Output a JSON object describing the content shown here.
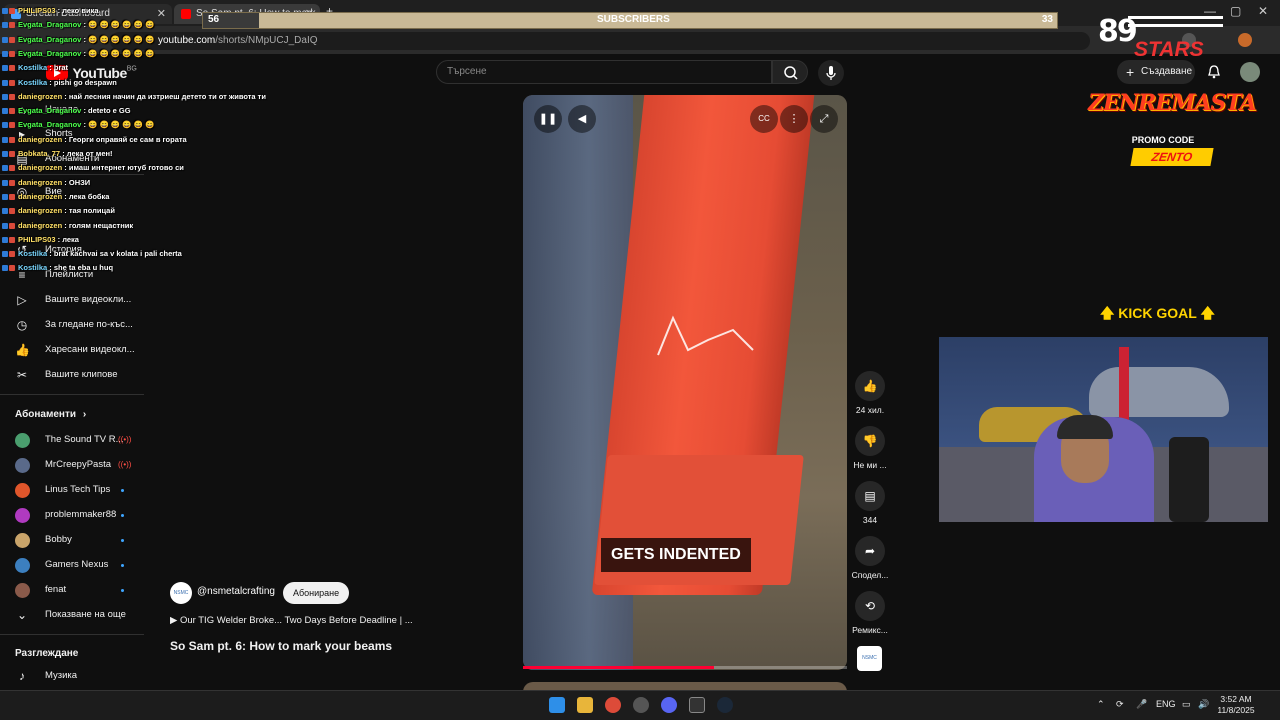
{
  "browser": {
    "tabs": [
      {
        "label": "Stream Dashboard",
        "close": "✕"
      },
      {
        "label": "So Sam pt. 6: How to mark",
        "close": "✕"
      }
    ],
    "new_tab": "+",
    "url_host": "youtube.com",
    "url_path": "/shorts/NMpUCJ_DaIQ",
    "window_controls": [
      "—",
      "▢",
      "✕"
    ]
  },
  "overlay": {
    "subscribers_label": "SUBSCRIBERS",
    "subscribers_current": "56",
    "subscribers_goal": "33",
    "subscribers_progress": 0.066,
    "brand_number": "89",
    "brand_word": "STARS",
    "sponsor_name": "ZENREMASTA",
    "promo_label": "PROMO CODE",
    "promo_code": "ZENTO",
    "kick_goal": "KICK GOAL",
    "chat": [
      {
        "user": "PHILIPS03",
        "text": "леко вика"
      },
      {
        "user": "Evgata_Draganov",
        "text": "😄 😄 😄 😄 😄 😄"
      },
      {
        "user": "Evgata_Draganov",
        "text": "😄 😄 😄 😄 😄 😄"
      },
      {
        "user": "Evgata_Draganov",
        "text": "😄 😄 😄 😄 😄 😄"
      },
      {
        "user": "Kostilka",
        "text": "brat"
      },
      {
        "user": "Kostilka",
        "text": "pishi go despawn"
      },
      {
        "user": "daniegrozen",
        "text": "най лесния начин да изтриеш детето ти от живота ти"
      },
      {
        "user": "Evgata_Draganov",
        "text": "deteto e GG"
      },
      {
        "user": "Evgata_Draganov",
        "text": "😄 😄 😄 😄 😄 😄"
      },
      {
        "user": "daniegrozen",
        "text": "Георги оправяй се сам в гората"
      },
      {
        "user": "Bobkata_77",
        "text": "лека от мен!"
      },
      {
        "user": "daniegrozen",
        "text": "имаш интернет ютуб готово си"
      },
      {
        "user": "daniegrozen",
        "text": "ОНЗИ"
      },
      {
        "user": "daniegrozen",
        "text": "лека бобка"
      },
      {
        "user": "daniegrozen",
        "text": "тая полицай"
      },
      {
        "user": "daniegrozen",
        "text": "голям нещастник"
      },
      {
        "user": "PHILIPS03",
        "text": "лека"
      },
      {
        "user": "Kostilka",
        "text": "brat kachvai sa v kolata i pali cherta"
      },
      {
        "user": "Kostilka",
        "text": "she ta eba u huq"
      }
    ]
  },
  "header": {
    "logo": "YouTube",
    "logo_region": "BG",
    "search_placeholder": "Търсене",
    "create_label": "Създаване"
  },
  "sidebar": {
    "top_items": [
      {
        "label": "Начало",
        "icon": "home-icon",
        "glyph": "⌂"
      },
      {
        "label": "Shorts",
        "icon": "shorts-icon",
        "glyph": "▸"
      },
      {
        "label": "Абонаменти",
        "icon": "subscriptions-icon",
        "glyph": "▤"
      }
    ],
    "you_items": [
      {
        "label": "Вие",
        "icon": "you-icon",
        "glyph": "◎"
      },
      {
        "label": "История",
        "icon": "history-icon",
        "glyph": "↺"
      },
      {
        "label": "Плейлисти",
        "icon": "playlists-icon",
        "glyph": "≡"
      },
      {
        "label": "Вашите видеокли...",
        "icon": "your-videos-icon",
        "glyph": "▷"
      },
      {
        "label": "За гледане по-къс...",
        "icon": "watch-later-icon",
        "glyph": "◷"
      },
      {
        "label": "Харесани видеокл...",
        "icon": "liked-videos-icon",
        "glyph": "👍"
      },
      {
        "label": "Вашите клипове",
        "icon": "clips-icon",
        "glyph": "✂"
      }
    ],
    "subs_title": "Абонаменти",
    "subs_chevron": "›",
    "subscriptions": [
      {
        "label": "The Sound TV R...",
        "color": "#4a9e6e",
        "status": "live"
      },
      {
        "label": "MrCreepyPasta",
        "color": "#5a6a8a",
        "status": "live"
      },
      {
        "label": "Linus Tech Tips",
        "color": "#e0562b",
        "status": "new"
      },
      {
        "label": "problemmaker88",
        "color": "#b03ac0",
        "status": "new"
      },
      {
        "label": "Bobby",
        "color": "#c9a46a",
        "status": "new"
      },
      {
        "label": "Gamers Nexus",
        "color": "#3c7fbf",
        "status": "new"
      },
      {
        "label": "fenat",
        "color": "#8a5a4a",
        "status": "new"
      }
    ],
    "show_more": "Показване на още",
    "explore_title": "Разглеждане",
    "explore_items": [
      {
        "label": "Музика",
        "icon": "music-icon",
        "glyph": "♪"
      }
    ]
  },
  "short": {
    "caption": "GETS INDENTED",
    "channel": "@nsmetalcrafting",
    "channel_abbr": "NSMC",
    "subscribe_label": "Абониране",
    "playlist": "Our TIG Welder Broke... Two Days Before Deadline | ...",
    "title": "So Sam pt. 6: How to mark your beams",
    "progress": 0.59,
    "actions": [
      {
        "name": "like-button",
        "icon": "thumbs-up-icon",
        "glyph": "👍",
        "label": "24 хил."
      },
      {
        "name": "dislike-button",
        "icon": "thumbs-down-icon",
        "glyph": "👎",
        "label": "Не ми ..."
      },
      {
        "name": "comments-button",
        "icon": "comment-icon",
        "glyph": "▤",
        "label": "344"
      },
      {
        "name": "share-button",
        "icon": "share-icon",
        "glyph": "➦",
        "label": "Сподел..."
      },
      {
        "name": "remix-button",
        "icon": "remix-icon",
        "glyph": "⟲",
        "label": "Ремикс..."
      }
    ]
  },
  "taskbar": {
    "language": "ENG",
    "time": "3:52 AM",
    "date": "11/8/2025"
  },
  "colors": {
    "yt_red": "#ff0000",
    "accent_blue": "#3ea6ff",
    "beam_orange": "#f2573b",
    "kick_yellow": "#ffd400"
  }
}
